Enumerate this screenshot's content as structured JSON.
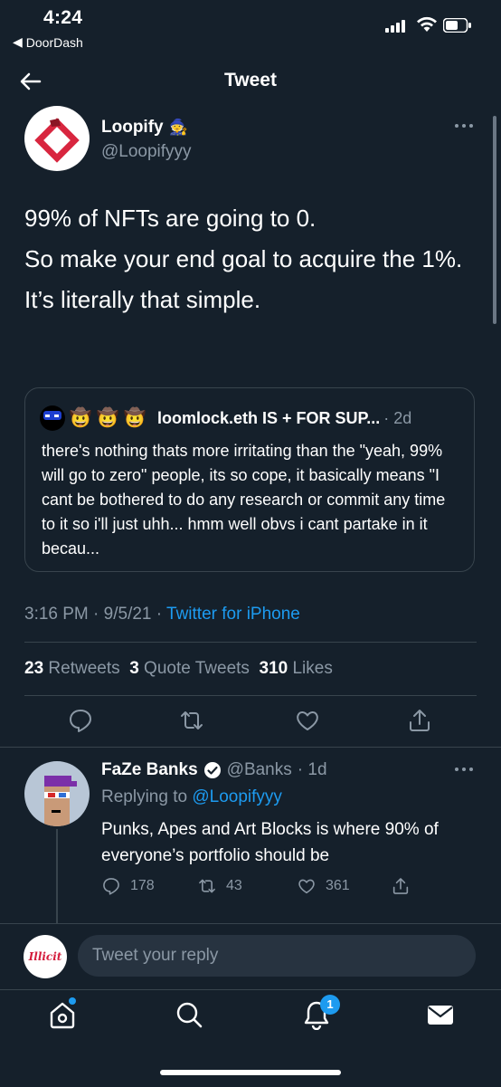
{
  "status_bar": {
    "time": "4:24",
    "back_app": "DoorDash"
  },
  "nav": {
    "title": "Tweet"
  },
  "tweet": {
    "author_name": "Loopify",
    "author_emoji": "🧙",
    "author_handle": "@Loopifyyy",
    "paragraphs": [
      "99% of NFTs are going to 0.",
      "So make your end goal to acquire the 1%.",
      "It’s literally that simple."
    ],
    "quote": {
      "badges": [
        "🤠",
        "🤠",
        "🤠"
      ],
      "name": "loomlock.eth IS + FOR SUP...",
      "time": "· 2d",
      "text": "there's nothing thats more irritating than the \"yeah, 99% will go to zero\" people, its so cope, it basically means \"I cant be bothered to do any research or commit any time to it so i'll just uhh... hmm well obvs i cant partake in it becau..."
    },
    "time": "3:16 PM",
    "date": "9/5/21",
    "source": "Twitter for iPhone",
    "retweets_count": "23",
    "retweets_label": "Retweets",
    "quotes_count": "3",
    "quotes_label": "Quote Tweets",
    "likes_count": "310",
    "likes_label": "Likes"
  },
  "reply": {
    "name": "FaZe Banks",
    "handle": "@Banks",
    "time": "· 1d",
    "replying_prefix": "Replying to",
    "replying_handle": "@Loopifyyy",
    "text": "Punks, Apes and Art Blocks is where 90% of everyone’s portfolio should be",
    "reply_count": "178",
    "retweet_count": "43",
    "like_count": "361"
  },
  "compose": {
    "avatar_text": "Illicit",
    "placeholder": "Tweet your reply"
  },
  "tabbar": {
    "notification_badge": "1"
  },
  "colors": {
    "background": "#15202b",
    "accent": "#1d9bf0",
    "muted": "#8b98a5",
    "border": "#38444d"
  }
}
